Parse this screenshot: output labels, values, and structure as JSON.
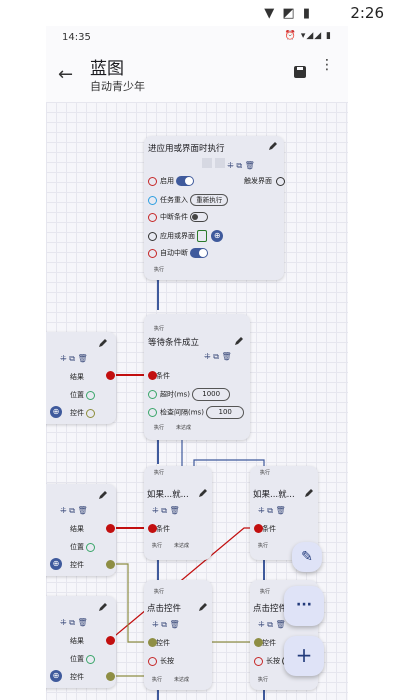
{
  "device_status": {
    "time": "2:26",
    "icons": "▼ ◩ ▮"
  },
  "phone_status": {
    "time": "14:35",
    "icons": "⏰ ▾◢◢ ▮"
  },
  "appbar": {
    "title": "蓝图",
    "subtitle": "自动青少年"
  },
  "ports": {
    "exec": "执行",
    "not_reached": "未达成"
  },
  "node_start": {
    "title": "进应用或界面时执行",
    "enable": "启用",
    "trigger_ui": "触发界面",
    "task_reentry": "任务重入",
    "restart": "重新执行",
    "interrupt_condition": "中断条件",
    "app_or_ui": "应用或界面",
    "auto_interrupt": "自动中断"
  },
  "node_wait": {
    "title": "等待条件成立",
    "condition": "条件",
    "timeout_label": "超时(ms)",
    "timeout_value": "1000",
    "interval_label": "检查间隔(ms)",
    "interval_value": "100"
  },
  "node_left": {
    "result": "结果",
    "position": "位置",
    "control": "控件"
  },
  "node_if": {
    "title": "如果...就...",
    "condition": "条件"
  },
  "node_click": {
    "title": "点击控件",
    "control": "控件",
    "long_press": "长按"
  },
  "fabs": {
    "edit": "✎",
    "more": "···",
    "add": "+"
  },
  "colors": {
    "accent": "#3f5a9c",
    "wire_red": "#c20f0f",
    "wire_olive": "#8e8e44",
    "wire_navy": "#3f5a9c"
  }
}
